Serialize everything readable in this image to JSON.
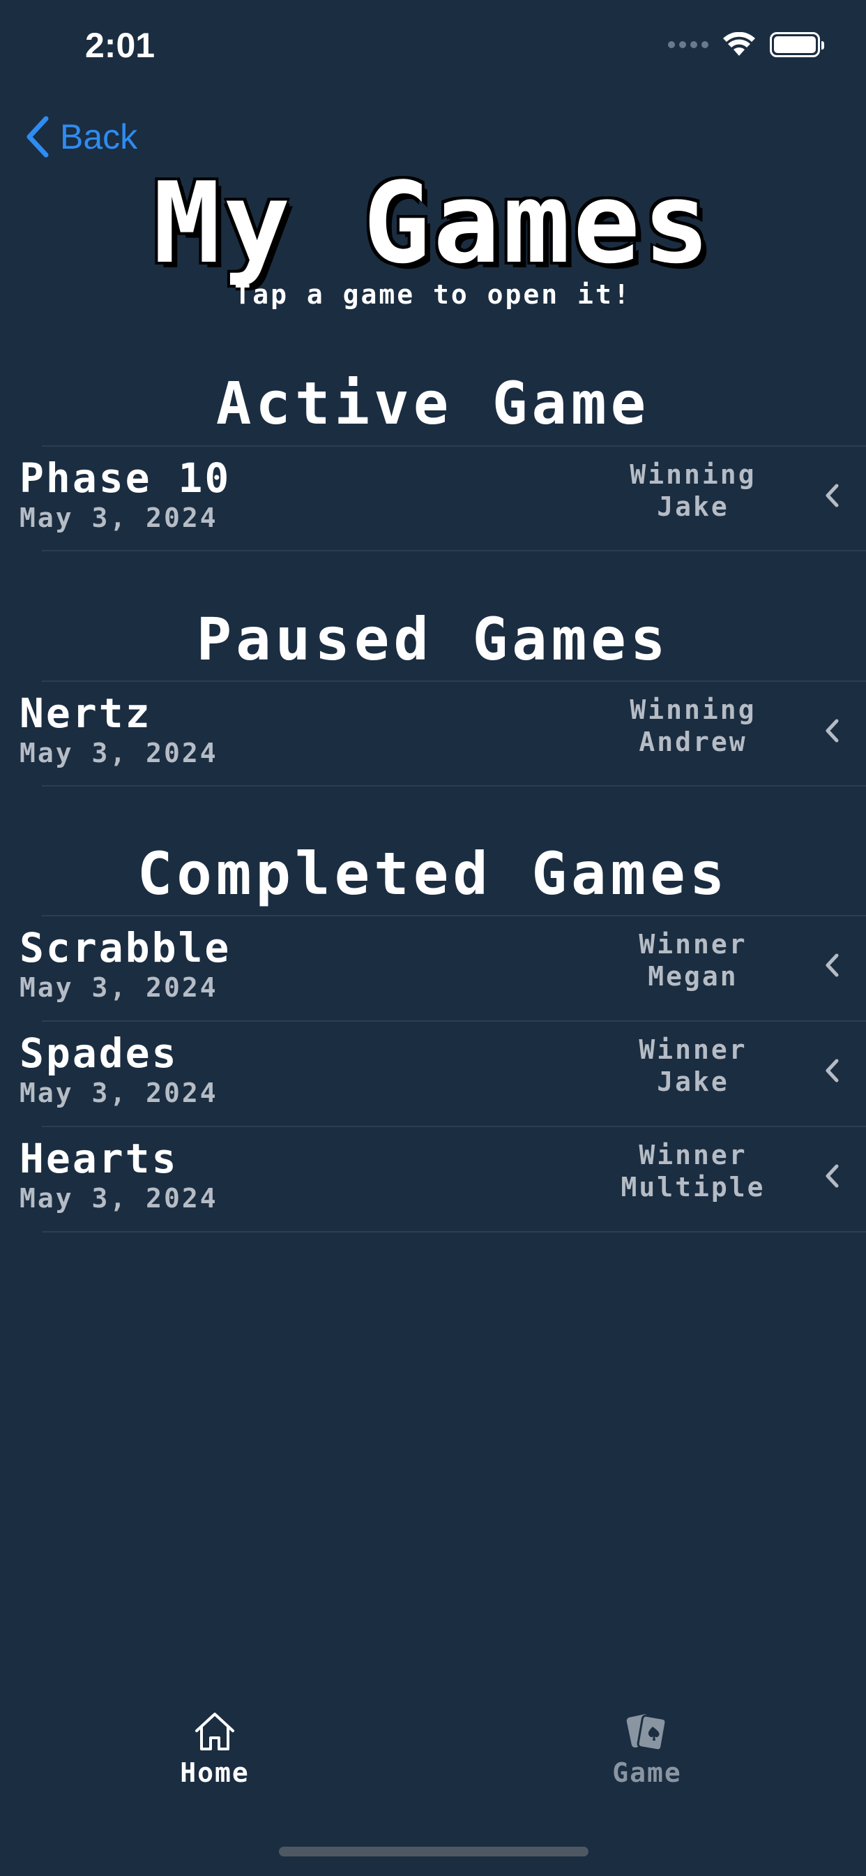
{
  "status_bar": {
    "time": "2:01"
  },
  "nav": {
    "back_label": "Back"
  },
  "header": {
    "title": "My Games",
    "subtitle": "Tap a game to open it!"
  },
  "sections": {
    "active": {
      "title": "Active Game",
      "games": [
        {
          "name": "Phase 10",
          "date": "May 3, 2024",
          "status_label": "Winning",
          "status_value": "Jake"
        }
      ]
    },
    "paused": {
      "title": "Paused Games",
      "games": [
        {
          "name": "Nertz",
          "date": "May 3, 2024",
          "status_label": "Winning",
          "status_value": "Andrew"
        }
      ]
    },
    "completed": {
      "title": "Completed Games",
      "games": [
        {
          "name": "Scrabble",
          "date": "May 3, 2024",
          "status_label": "Winner",
          "status_value": "Megan"
        },
        {
          "name": "Spades",
          "date": "May 3, 2024",
          "status_label": "Winner",
          "status_value": "Jake"
        },
        {
          "name": "Hearts",
          "date": "May 3, 2024",
          "status_label": "Winner",
          "status_value": "Multiple"
        }
      ]
    }
  },
  "tab_bar": {
    "home_label": "Home",
    "home_icon": "house-icon",
    "game_label": "Game",
    "game_icon": "playing-cards-icon"
  },
  "colors": {
    "background": "#1b2d41",
    "accent": "#2f8cf0",
    "secondary_text": "#b5bcc5"
  }
}
